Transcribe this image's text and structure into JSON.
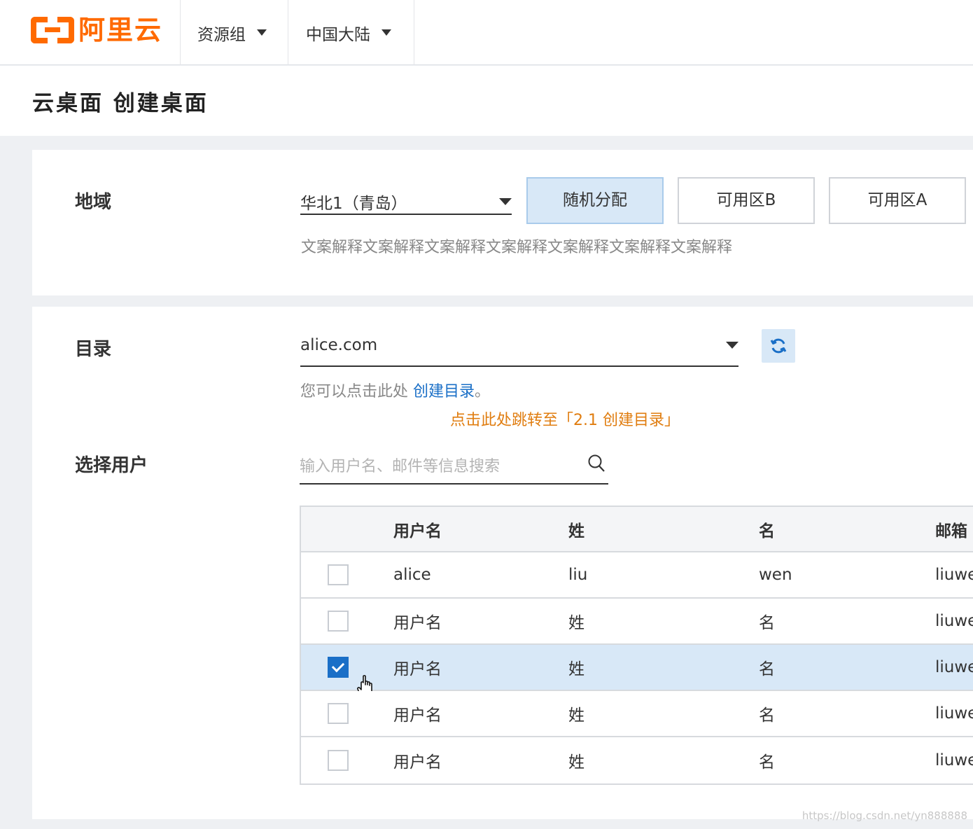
{
  "header": {
    "logo_text": "阿里云",
    "resource_group": "资源组",
    "region": "中国大陆"
  },
  "page": {
    "title": "云桌面 创建桌面"
  },
  "region_section": {
    "label": "地域",
    "selected": "华北1（青岛）",
    "zones": [
      "随机分配",
      "可用区B",
      "可用区A"
    ],
    "active_zone": "随机分配",
    "hint": "文案解释文案解释文案解释文案解释文案解释文案解释文案解释"
  },
  "directory_section": {
    "label": "目录",
    "selected": "alice.com",
    "hint_prefix": "您可以点击此处 ",
    "hint_link": "创建目录",
    "hint_suffix": "。",
    "note": "点击此处跳转至「2.1 创建目录」"
  },
  "user_section": {
    "label": "选择用户",
    "search_placeholder": "输入用户名、邮件等信息搜索",
    "columns": [
      "用户名",
      "姓",
      "名",
      "邮箱"
    ],
    "rows": [
      {
        "username": "alice",
        "last": "liu",
        "first": "wen",
        "email": "liuwe",
        "checked": false
      },
      {
        "username": "用户名",
        "last": "姓",
        "first": "名",
        "email": "liuwe",
        "checked": false
      },
      {
        "username": "用户名",
        "last": "姓",
        "first": "名",
        "email": "liuwe",
        "checked": true
      },
      {
        "username": "用户名",
        "last": "姓",
        "first": "名",
        "email": "liuwe",
        "checked": false
      },
      {
        "username": "用户名",
        "last": "姓",
        "first": "名",
        "email": "liuwe",
        "checked": false
      }
    ]
  },
  "watermark": "https://blog.csdn.net/yn888888",
  "colors": {
    "brand": "#ff6a00",
    "link": "#1a6fc7",
    "note": "#e07d10",
    "selected_bg": "#d8e8f7"
  }
}
